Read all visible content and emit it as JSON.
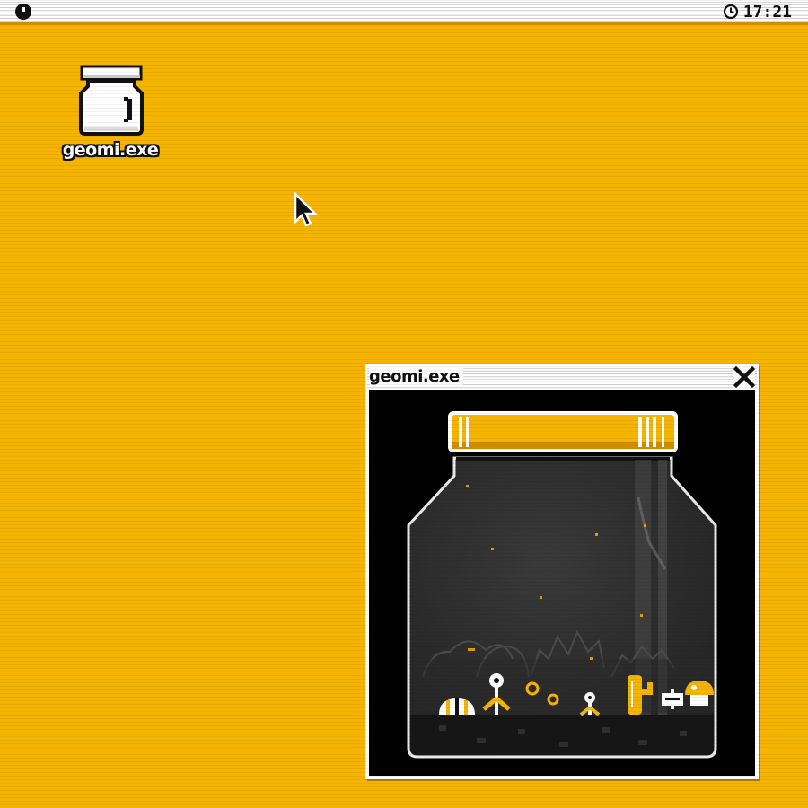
{
  "menubar": {
    "logo_icon": "system-menu-icon",
    "clock_icon": "clock-icon",
    "time": "17:21"
  },
  "desktop": {
    "background_color": "#f5b400",
    "icons": [
      {
        "label": "geomi.exe",
        "icon": "jar-icon"
      }
    ]
  },
  "window": {
    "title": "geomi.exe",
    "close_icon": "close-icon",
    "content": "terrarium-jar-scene"
  },
  "colors": {
    "accent": "#f5b400",
    "accent_dark": "#cf8f00",
    "ink": "#111111",
    "paper": "#ffffff"
  }
}
